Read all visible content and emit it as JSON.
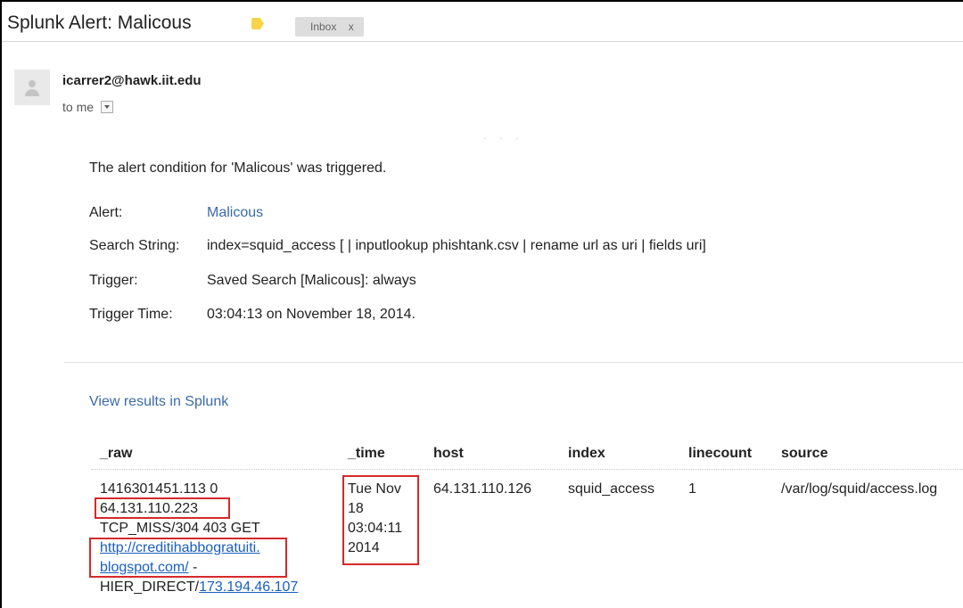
{
  "email": {
    "subject": "Splunk Alert: Malicous",
    "label_color": "#f7d44a",
    "inbox_chip": {
      "label": "Inbox",
      "close": "x"
    },
    "sender": "icarrer2@hawk.iit.edu",
    "recipient": "to me",
    "dots": "· · ·"
  },
  "body": {
    "intro": "The alert condition for 'Malicous' was triggered.",
    "fields": [
      {
        "key": "Alert:",
        "value": "Malicous",
        "is_link": true
      },
      {
        "key": "Search String:",
        "value": "index=squid_access [ | inputlookup phishtank.csv | rename url as uri | fields uri]",
        "is_link": false
      },
      {
        "key": "Trigger:",
        "value": "Saved Search [Malicous]: always",
        "is_link": false
      },
      {
        "key": "Trigger Time:",
        "value": "03:04:13 on November 18, 2014.",
        "is_link": false
      }
    ],
    "view_results": "View results in Splunk"
  },
  "results": {
    "columns": [
      "_raw",
      "_time",
      "host",
      "index",
      "linecount",
      "source"
    ],
    "row": {
      "raw": {
        "line1": "1416301451.113 0",
        "ip": "64.131.110.223",
        "line3": "TCP_MISS/304 403 GET",
        "url_part1": "http://creditihabbogratuiti.",
        "url_part2": "blogspot.com/",
        "url_suffix": " -",
        "hier": "HIER_DIRECT/",
        "hier_ip": "173.194.46.107"
      },
      "time": [
        "Tue Nov",
        "18",
        "03:04:11",
        "2014"
      ],
      "host": "64.131.110.126",
      "index": "squid_access",
      "linecount": "1",
      "source": "/var/log/squid/access.log"
    },
    "highlight_color": "#d42a2a",
    "link_color": "#1a5fbf"
  }
}
